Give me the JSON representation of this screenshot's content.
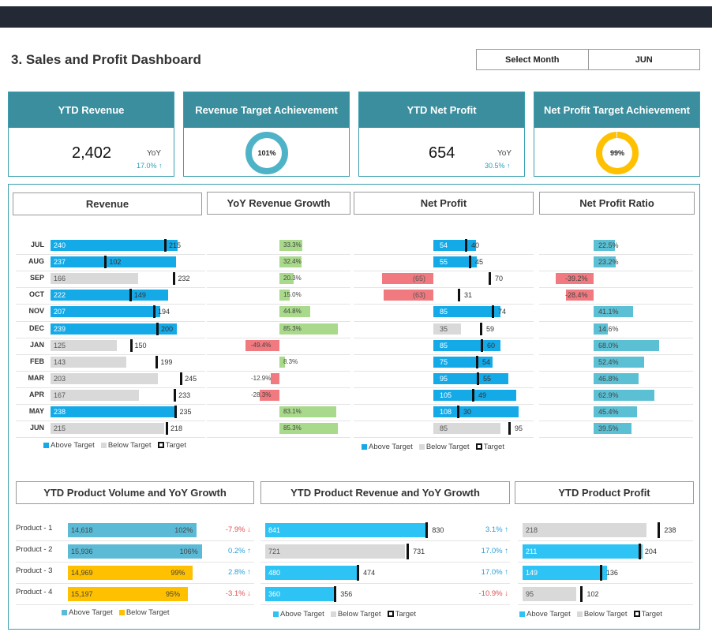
{
  "header": {
    "title": "3. Sales and Profit Dashboard",
    "select_label": "Select Month",
    "select_value": "JUN"
  },
  "colors": {
    "above": "#14aae8",
    "below": "#d9d9d9",
    "growth_pos": "#a9d98a",
    "growth_neg": "#f07a80",
    "ratio_pos": "#5bc0d4",
    "ratio_neg": "#f07a80",
    "teal": "#3a8e9e",
    "yellow": "#ffc000",
    "prod_vol": "#5bbad6",
    "prod_vol_low": "#ffc000",
    "prod_bar": "#2dc3f5"
  },
  "kpis": [
    {
      "title": "YTD Revenue",
      "value": "2,402",
      "yoy_label": "YoY",
      "yoy_value": "17.0% ↑"
    },
    {
      "title": "Revenue Target Achievement",
      "donut": "101%",
      "pct": 100
    },
    {
      "title": "YTD Net Profit",
      "value": "654",
      "yoy_label": "YoY",
      "yoy_value": "30.5% ↑"
    },
    {
      "title": "Net Profit Target Achievement",
      "donut": "99%",
      "pct": 99
    }
  ],
  "sections": {
    "revenue": "Revenue",
    "yoy": "YoY Revenue Growth",
    "net_profit": "Net Profit",
    "ratio": "Net Profit Ratio",
    "prod_vol": "YTD Product Volume and YoY Growth",
    "prod_rev": "YTD Product Revenue and YoY Growth",
    "prod_profit": "YTD Product Profit"
  },
  "months": [
    {
      "m": "JUL",
      "rev": 240,
      "rev_t": 215,
      "rev_lbl": "240",
      "rev_tl": "215",
      "yoy": 33.3,
      "yoy_lbl": "33.3%",
      "np": 54,
      "np_t": 40,
      "np_lbl": "54",
      "np_tl": "40",
      "ratio": 22.5,
      "ratio_lbl": "22.5%"
    },
    {
      "m": "AUG",
      "rev": 237,
      "rev_t": 102,
      "rev_lbl": "237",
      "rev_tl": "102",
      "yoy": 32.4,
      "yoy_lbl": "32.4%",
      "np": 55,
      "np_t": 45,
      "np_lbl": "55",
      "np_tl": "45",
      "ratio": 23.2,
      "ratio_lbl": "23.2%"
    },
    {
      "m": "SEP",
      "rev": 166,
      "rev_t": 232,
      "rev_lbl": "166",
      "rev_tl": "232",
      "yoy": 20.3,
      "yoy_lbl": "20.3%",
      "np": -65,
      "np_t": 70,
      "np_lbl": "(65)",
      "np_tl": "70",
      "ratio": -39.2,
      "ratio_lbl": "-39.2%"
    },
    {
      "m": "OCT",
      "rev": 222,
      "rev_t": 149,
      "rev_lbl": "222",
      "rev_tl": "149",
      "yoy": 15.0,
      "yoy_lbl": "15.0%",
      "np": -63,
      "np_t": 31,
      "np_lbl": "(63)",
      "np_tl": "31",
      "ratio": -28.4,
      "ratio_lbl": "-28.4%"
    },
    {
      "m": "NOV",
      "rev": 207,
      "rev_t": 194,
      "rev_lbl": "207",
      "rev_tl": "194",
      "yoy": 44.8,
      "yoy_lbl": "44.8%",
      "np": 85,
      "np_t": 74,
      "np_lbl": "85",
      "np_tl": "74",
      "ratio": 41.1,
      "ratio_lbl": "41.1%"
    },
    {
      "m": "DEC",
      "rev": 239,
      "rev_t": 200,
      "rev_lbl": "239",
      "rev_tl": "200",
      "yoy": 85.3,
      "yoy_lbl": "85.3%",
      "np": 35,
      "np_t": 59,
      "np_lbl": "35",
      "np_tl": "59",
      "ratio": 14.6,
      "ratio_lbl": "14.6%"
    },
    {
      "m": "JAN",
      "rev": 125,
      "rev_t": 150,
      "rev_lbl": "125",
      "rev_tl": "150",
      "yoy": -49.4,
      "yoy_lbl": "-49.4%",
      "np": 85,
      "np_t": 60,
      "np_lbl": "85",
      "np_tl": "60",
      "ratio": 68.0,
      "ratio_lbl": "68.0%"
    },
    {
      "m": "FEB",
      "rev": 143,
      "rev_t": 199,
      "rev_lbl": "143",
      "rev_tl": "199",
      "yoy": 8.3,
      "yoy_lbl": "8.3%",
      "np": 75,
      "np_t": 54,
      "np_lbl": "75",
      "np_tl": "54",
      "ratio": 52.4,
      "ratio_lbl": "52.4%"
    },
    {
      "m": "MAR",
      "rev": 203,
      "rev_t": 245,
      "rev_lbl": "203",
      "rev_tl": "245",
      "yoy": -12.9,
      "yoy_lbl": "-12.9%",
      "np": 95,
      "np_t": 55,
      "np_lbl": "95",
      "np_tl": "55",
      "ratio": 46.8,
      "ratio_lbl": "46.8%"
    },
    {
      "m": "APR",
      "rev": 167,
      "rev_t": 233,
      "rev_lbl": "167",
      "rev_tl": "233",
      "yoy": -28.3,
      "yoy_lbl": "-28.3%",
      "np": 105,
      "np_t": 49,
      "np_lbl": "105",
      "np_tl": "49",
      "ratio": 62.9,
      "ratio_lbl": "62.9%"
    },
    {
      "m": "MAY",
      "rev": 238,
      "rev_t": 235,
      "rev_lbl": "238",
      "rev_tl": "235",
      "yoy": 83.1,
      "yoy_lbl": "83.1%",
      "np": 108,
      "np_t": 30,
      "np_lbl": "108",
      "np_tl": "30",
      "ratio": 45.4,
      "ratio_lbl": "45.4%"
    },
    {
      "m": "JUN",
      "rev": 215,
      "rev_t": 218,
      "rev_lbl": "215",
      "rev_tl": "218",
      "yoy": 85.3,
      "yoy_lbl": "85.3%",
      "np": 85,
      "np_t": 95,
      "np_lbl": "85",
      "np_tl": "95",
      "ratio": 39.5,
      "ratio_lbl": "39.5%"
    }
  ],
  "legend": {
    "above": "Above Target",
    "below": "Below Target",
    "target": "Target"
  },
  "products": [
    {
      "name": "Product - 1",
      "vol": "14,618",
      "vol_pct": "102%",
      "vol_above": true,
      "vol_ratio": 1.02,
      "vol_growth": "-7.9% ↓",
      "vol_up": false,
      "rev": 841,
      "rev_t": 830,
      "rev_growth": "3.1% ↑",
      "rev_up": true,
      "profit": 218,
      "profit_t": 238
    },
    {
      "name": "Product - 2",
      "vol": "15,936",
      "vol_pct": "106%",
      "vol_above": true,
      "vol_ratio": 1.06,
      "vol_growth": "0.2% ↑",
      "vol_up": true,
      "rev": 721,
      "rev_t": 731,
      "rev_growth": "17.0% ↑",
      "rev_up": true,
      "profit": 211,
      "profit_t": 204
    },
    {
      "name": "Product - 3",
      "vol": "14,969",
      "vol_pct": "99%",
      "vol_above": false,
      "vol_ratio": 0.99,
      "vol_growth": "2.8% ↑",
      "vol_up": true,
      "rev": 480,
      "rev_t": 474,
      "rev_growth": "17.0% ↑",
      "rev_up": true,
      "profit": 149,
      "profit_t": 136
    },
    {
      "name": "Product - 4",
      "vol": "15,197",
      "vol_pct": "95%",
      "vol_above": false,
      "vol_ratio": 0.95,
      "vol_growth": "-3.1% ↓",
      "vol_up": false,
      "rev": 360,
      "rev_t": 356,
      "rev_growth": "-10.9% ↓",
      "rev_up": false,
      "profit": 95,
      "profit_t": 102
    }
  ]
}
